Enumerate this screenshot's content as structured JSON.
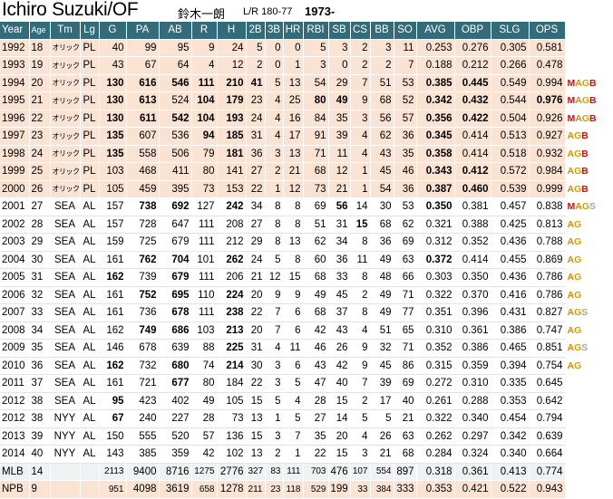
{
  "header": {
    "name": "Ichiro Suzuki/OF",
    "japanese_name": "鈴木一朗",
    "bio": "L/R 180-77",
    "born": "1973-"
  },
  "columns": [
    "Year",
    "Age",
    "Tm",
    "Lg",
    "G",
    "PA",
    "AB",
    "R",
    "H",
    "2B",
    "3B",
    "HR",
    "RBI",
    "SB",
    "CS",
    "BB",
    "SO",
    "AVG",
    "OBP",
    "SLG",
    "OPS"
  ],
  "rows": [
    {
      "type": "npb",
      "cells": [
        "1992",
        "18",
        "オリックス",
        "PL",
        "40",
        "99",
        "95",
        "9",
        "24",
        "5",
        "0",
        "0",
        "5",
        "3",
        "2",
        "3",
        "11",
        "0.253",
        "0.276",
        "0.305",
        "0.581"
      ],
      "bold": [],
      "awards": ""
    },
    {
      "type": "npb",
      "cells": [
        "1993",
        "19",
        "オリックス",
        "PL",
        "43",
        "67",
        "64",
        "4",
        "12",
        "2",
        "0",
        "1",
        "3",
        "0",
        "2",
        "2",
        "7",
        "0.188",
        "0.212",
        "0.266",
        "0.478"
      ],
      "bold": [],
      "awards": ""
    },
    {
      "type": "npb",
      "cells": [
        "1994",
        "20",
        "オリックス",
        "PL",
        "130",
        "616",
        "546",
        "111",
        "210",
        "41",
        "5",
        "13",
        "54",
        "29",
        "7",
        "51",
        "53",
        "0.385",
        "0.445",
        "0.549",
        "0.994"
      ],
      "bold": [
        "G",
        "PA",
        "AB",
        "R",
        "H",
        "2B",
        "AVG",
        "OBP"
      ],
      "awards": "MAGB"
    },
    {
      "type": "npb",
      "cells": [
        "1995",
        "21",
        "オリックス",
        "PL",
        "130",
        "613",
        "524",
        "104",
        "179",
        "23",
        "4",
        "25",
        "80",
        "49",
        "9",
        "68",
        "52",
        "0.342",
        "0.432",
        "0.544",
        "0.976"
      ],
      "bold": [
        "G",
        "PA",
        "R",
        "H",
        "RBI",
        "SB",
        "AVG",
        "OBP",
        "OPS"
      ],
      "awards": "MAGB"
    },
    {
      "type": "npb",
      "cells": [
        "1996",
        "22",
        "オリックス",
        "PL",
        "130",
        "611",
        "542",
        "104",
        "193",
        "24",
        "4",
        "16",
        "84",
        "35",
        "3",
        "56",
        "57",
        "0.356",
        "0.422",
        "0.504",
        "0.926"
      ],
      "bold": [
        "G",
        "PA",
        "AB",
        "R",
        "H",
        "AVG",
        "OBP"
      ],
      "awards": "MAGB"
    },
    {
      "type": "npb",
      "cells": [
        "1997",
        "23",
        "オリックス",
        "PL",
        "135",
        "607",
        "536",
        "94",
        "185",
        "31",
        "4",
        "17",
        "91",
        "39",
        "4",
        "62",
        "36",
        "0.345",
        "0.414",
        "0.513",
        "0.927"
      ],
      "bold": [
        "G",
        "R",
        "H",
        "AVG"
      ],
      "awards": "AGB"
    },
    {
      "type": "npb",
      "cells": [
        "1998",
        "24",
        "オリックス",
        "PL",
        "135",
        "558",
        "506",
        "79",
        "181",
        "36",
        "3",
        "13",
        "71",
        "11",
        "4",
        "43",
        "35",
        "0.358",
        "0.414",
        "0.518",
        "0.932"
      ],
      "bold": [
        "G",
        "H",
        "AVG"
      ],
      "awards": "AGB"
    },
    {
      "type": "npb",
      "cells": [
        "1999",
        "25",
        "オリックス",
        "PL",
        "103",
        "468",
        "411",
        "80",
        "141",
        "27",
        "2",
        "21",
        "68",
        "12",
        "1",
        "45",
        "46",
        "0.343",
        "0.412",
        "0.572",
        "0.984"
      ],
      "bold": [
        "AVG",
        "OBP"
      ],
      "awards": "AGB"
    },
    {
      "type": "npb",
      "cells": [
        "2000",
        "26",
        "オリックス",
        "PL",
        "105",
        "459",
        "395",
        "73",
        "153",
        "22",
        "1",
        "12",
        "73",
        "21",
        "1",
        "54",
        "36",
        "0.387",
        "0.460",
        "0.539",
        "0.999"
      ],
      "bold": [
        "AVG",
        "OBP"
      ],
      "awards": "AGB"
    },
    {
      "type": "mlb",
      "cells": [
        "2001",
        "27",
        "SEA",
        "AL",
        "157",
        "738",
        "692",
        "127",
        "242",
        "34",
        "8",
        "8",
        "69",
        "56",
        "14",
        "30",
        "53",
        "0.350",
        "0.381",
        "0.457",
        "0.838"
      ],
      "bold": [
        "PA",
        "AB",
        "H",
        "SB",
        "AVG"
      ],
      "awards": "MAGS"
    },
    {
      "type": "mlb",
      "cells": [
        "2002",
        "28",
        "SEA",
        "AL",
        "157",
        "728",
        "647",
        "111",
        "208",
        "27",
        "8",
        "8",
        "51",
        "31",
        "15",
        "68",
        "62",
        "0.321",
        "0.388",
        "0.425",
        "0.813"
      ],
      "bold": [
        "CS"
      ],
      "awards": "AG"
    },
    {
      "type": "mlb",
      "cells": [
        "2003",
        "29",
        "SEA",
        "AL",
        "159",
        "725",
        "679",
        "111",
        "212",
        "29",
        "8",
        "13",
        "62",
        "34",
        "8",
        "36",
        "69",
        "0.312",
        "0.352",
        "0.436",
        "0.788"
      ],
      "bold": [],
      "awards": "AG"
    },
    {
      "type": "mlb",
      "cells": [
        "2004",
        "30",
        "SEA",
        "AL",
        "161",
        "762",
        "704",
        "101",
        "262",
        "24",
        "5",
        "8",
        "60",
        "36",
        "11",
        "49",
        "63",
        "0.372",
        "0.414",
        "0.455",
        "0.869"
      ],
      "bold": [
        "PA",
        "AB",
        "H",
        "AVG"
      ],
      "awards": "AG"
    },
    {
      "type": "mlb",
      "cells": [
        "2005",
        "31",
        "SEA",
        "AL",
        "162",
        "739",
        "679",
        "111",
        "206",
        "21",
        "12",
        "15",
        "68",
        "33",
        "8",
        "48",
        "66",
        "0.303",
        "0.350",
        "0.436",
        "0.786"
      ],
      "bold": [
        "G",
        "AB"
      ],
      "awards": "AG"
    },
    {
      "type": "mlb",
      "cells": [
        "2006",
        "32",
        "SEA",
        "AL",
        "161",
        "752",
        "695",
        "110",
        "224",
        "20",
        "9",
        "9",
        "49",
        "45",
        "2",
        "49",
        "71",
        "0.322",
        "0.370",
        "0.416",
        "0.786"
      ],
      "bold": [
        "PA",
        "AB",
        "H"
      ],
      "awards": "AG"
    },
    {
      "type": "mlb",
      "cells": [
        "2007",
        "33",
        "SEA",
        "AL",
        "161",
        "736",
        "678",
        "111",
        "238",
        "22",
        "7",
        "6",
        "68",
        "37",
        "8",
        "49",
        "77",
        "0.351",
        "0.396",
        "0.431",
        "0.827"
      ],
      "bold": [
        "AB",
        "H"
      ],
      "awards": "AGS"
    },
    {
      "type": "mlb",
      "cells": [
        "2008",
        "34",
        "SEA",
        "AL",
        "162",
        "749",
        "686",
        "103",
        "213",
        "20",
        "7",
        "6",
        "42",
        "43",
        "4",
        "51",
        "65",
        "0.310",
        "0.361",
        "0.386",
        "0.747"
      ],
      "bold": [
        "PA",
        "AB",
        "H"
      ],
      "awards": "AG"
    },
    {
      "type": "mlb",
      "cells": [
        "2009",
        "35",
        "SEA",
        "AL",
        "146",
        "678",
        "639",
        "88",
        "225",
        "31",
        "4",
        "11",
        "46",
        "26",
        "9",
        "32",
        "71",
        "0.352",
        "0.386",
        "0.465",
        "0.851"
      ],
      "bold": [
        "H"
      ],
      "awards": "AGS"
    },
    {
      "type": "mlb",
      "cells": [
        "2010",
        "36",
        "SEA",
        "AL",
        "162",
        "732",
        "680",
        "74",
        "214",
        "30",
        "3",
        "6",
        "43",
        "42",
        "9",
        "45",
        "86",
        "0.315",
        "0.359",
        "0.394",
        "0.754"
      ],
      "bold": [
        "G",
        "AB",
        "H"
      ],
      "awards": "AG"
    },
    {
      "type": "mlb",
      "cells": [
        "2011",
        "37",
        "SEA",
        "AL",
        "161",
        "721",
        "677",
        "80",
        "184",
        "22",
        "3",
        "5",
        "47",
        "40",
        "7",
        "39",
        "69",
        "0.272",
        "0.310",
        "0.335",
        "0.645"
      ],
      "bold": [
        "AB"
      ],
      "awards": ""
    },
    {
      "type": "mlb",
      "cells": [
        "2012",
        "38",
        "SEA",
        "AL",
        "95",
        "423",
        "402",
        "49",
        "105",
        "15",
        "5",
        "4",
        "28",
        "15",
        "2",
        "17",
        "40",
        "0.261",
        "0.288",
        "0.353",
        "0.642"
      ],
      "bold": [
        "G"
      ],
      "awards": ""
    },
    {
      "type": "mlb",
      "cells": [
        "2012",
        "38",
        "NYY",
        "AL",
        "67",
        "240",
        "227",
        "28",
        "73",
        "13",
        "1",
        "5",
        "27",
        "14",
        "5",
        "5",
        "21",
        "0.322",
        "0.340",
        "0.454",
        "0.794"
      ],
      "bold": [
        "G"
      ],
      "awards": ""
    },
    {
      "type": "mlb",
      "cells": [
        "2013",
        "39",
        "NYY",
        "AL",
        "150",
        "555",
        "520",
        "57",
        "136",
        "15",
        "3",
        "7",
        "35",
        "20",
        "4",
        "26",
        "63",
        "0.262",
        "0.297",
        "0.342",
        "0.639"
      ],
      "bold": [],
      "awards": ""
    },
    {
      "type": "mlb",
      "cells": [
        "2014",
        "40",
        "NYY",
        "AL",
        "143",
        "385",
        "359",
        "42",
        "102",
        "13",
        "2",
        "1",
        "22",
        "15",
        "3",
        "21",
        "68",
        "0.284",
        "0.324",
        "0.340",
        "0.664"
      ],
      "bold": [],
      "awards": ""
    },
    {
      "type": "tot",
      "cells": [
        "MLB",
        "14",
        "",
        "",
        "2113",
        "9400",
        "8716",
        "1275",
        "2776",
        "327",
        "83",
        "111",
        "703",
        "476",
        "107",
        "554",
        "897",
        "0.318",
        "0.361",
        "0.413",
        "0.774"
      ],
      "bold": [],
      "awards": ""
    },
    {
      "type": "totnpb",
      "cells": [
        "NPB",
        "9",
        "",
        "",
        "951",
        "4098",
        "3619",
        "658",
        "1278",
        "211",
        "23",
        "118",
        "529",
        "199",
        "33",
        "384",
        "333",
        "0.353",
        "0.421",
        "0.522",
        "0.943"
      ],
      "bold": [],
      "awards": ""
    }
  ],
  "award_colors": {
    "M": "#cc1111",
    "A": "#e08a00",
    "G": "#d4a000",
    "B": "#cc1111",
    "S": "#a8a8a8"
  },
  "header_bg": "#336b7a",
  "npb_row_bg": "#fbe3d3"
}
